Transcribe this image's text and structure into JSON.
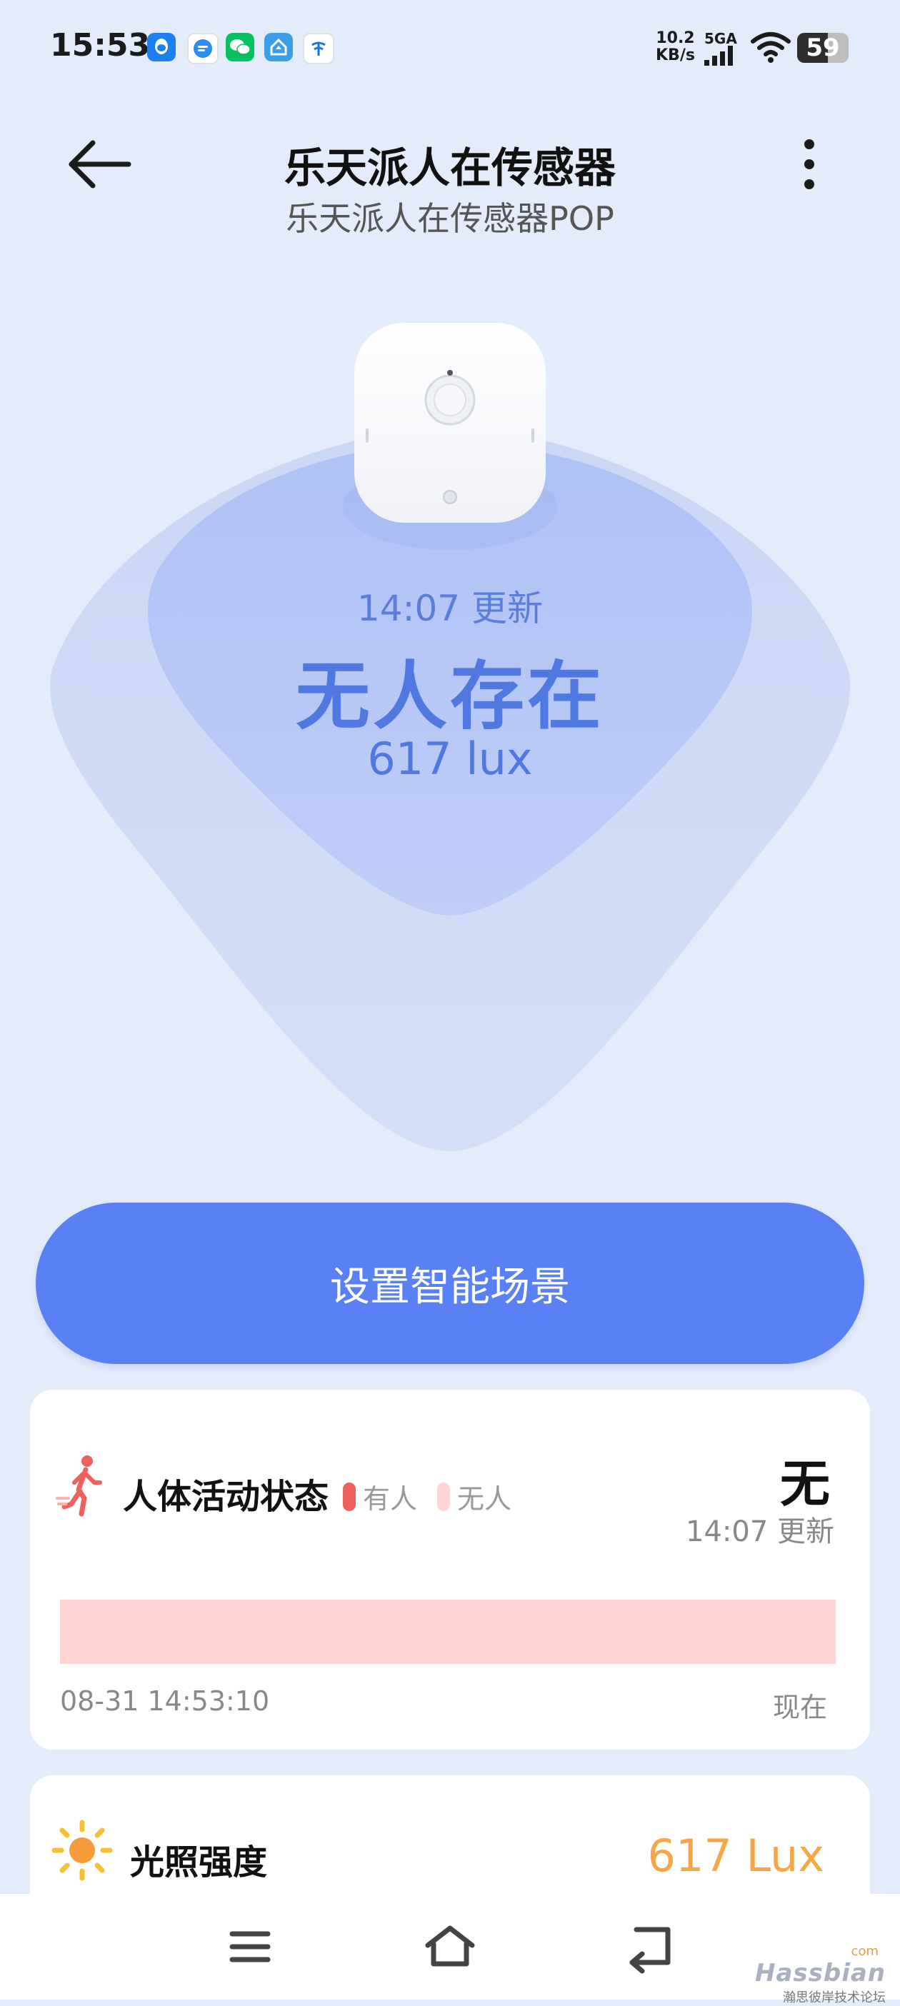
{
  "status_bar": {
    "time": "15:53",
    "net_speed_value": "10.2",
    "net_speed_unit": "KB/s",
    "network": "5GA",
    "battery": "59",
    "app_icons": [
      "qq-icon",
      "message-icon",
      "wechat-icon",
      "home-app-icon",
      "telecom-icon"
    ]
  },
  "header": {
    "title": "乐天派人在传感器",
    "subtitle": "乐天派人在传感器POP"
  },
  "hero": {
    "update_time": "14:07 更新",
    "presence": "无人存在",
    "lux": "617 lux"
  },
  "cta": {
    "label": "设置智能场景"
  },
  "activity_card": {
    "title": "人体活动状态",
    "legend_present": "有人",
    "legend_absent": "无人",
    "value": "无",
    "update_time": "14:07 更新",
    "timeline_start": "08-31 14:53:10",
    "timeline_end": "现在",
    "colors": {
      "present": "#f0605c",
      "absent": "#ffd4d2"
    }
  },
  "light_card": {
    "title": "光照强度",
    "value": "617 Lux"
  },
  "watermark": {
    "brand": "Hassbian",
    "tld": "com",
    "sub": "瀚思彼岸技术论坛"
  },
  "colors": {
    "background": "#e4ebfa",
    "accent": "#5a80f6",
    "hero_text": "#4f79e0",
    "lux_orange": "#f5a646"
  }
}
